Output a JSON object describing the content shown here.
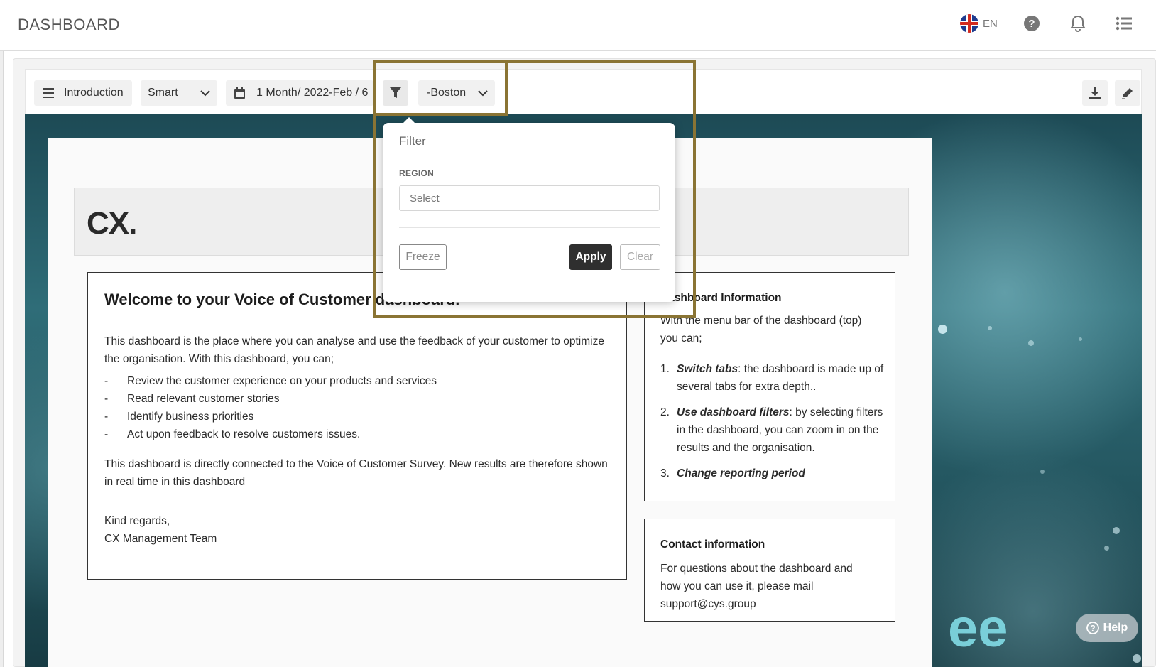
{
  "header": {
    "title": "DASHBOARD",
    "language": "EN"
  },
  "toolbar": {
    "tab_label": "Introduction",
    "view_label": "Smart",
    "period_label": "1 Month/ 2022-Feb / 6",
    "filter_value": "-Boston"
  },
  "banner": {
    "title": "CX."
  },
  "welcome": {
    "heading": "Welcome to your Voice of Customer dashboard.",
    "intro": "This dashboard is the place where you can analyse and use the feedback of your customer to optimize the organisation. With this dashboard, you can;",
    "bullets": [
      "Review the customer experience on your products and services",
      "Read relevant customer stories",
      "Identify business priorities",
      "Act upon feedback to resolve customers issues."
    ],
    "bullet_marker": "-",
    "connected": "This dashboard is directly connected to the Voice of Customer Survey. New results are therefore shown in real time in this dashboard",
    "regards": "Kind regards,",
    "team": "CX Management Team"
  },
  "info": {
    "heading": "Dashboard Information",
    "intro": "With the menu bar of the dashboard (top) you can;",
    "items": [
      {
        "num": "1.",
        "bold": "Switch tabs",
        "rest": ": the dashboard is made up of several tabs for extra depth.."
      },
      {
        "num": "2.",
        "bold": "Use dashboard filters",
        "rest": ": by selecting filters in the dashboard, you can zoom in on the results and the organisation."
      },
      {
        "num": "3.",
        "bold": "Change reporting period",
        "rest": ""
      }
    ]
  },
  "contact": {
    "heading": "Contact information",
    "text": "For questions about the dashboard and how you can use it, please mail support@cys.group"
  },
  "filter_popover": {
    "title": "Filter",
    "region_label": "REGION",
    "region_placeholder": "Select",
    "freeze_label": "Freeze",
    "apply_label": "Apply",
    "clear_label": "Clear"
  },
  "hero": {
    "overlay_text": "ee"
  },
  "help_button": {
    "label": "Help"
  },
  "colors": {
    "highlight": "#8a7434",
    "apply_bg": "#2f2f2f",
    "hero_teal": "#2f6d78"
  },
  "icons": [
    "globe-flag-uk-icon",
    "help-circle-icon",
    "bell-icon",
    "list-icon",
    "menu-icon",
    "chevron-down-icon",
    "calendar-icon",
    "filter-icon",
    "download-icon",
    "edit-pencil-icon",
    "help-icon"
  ]
}
